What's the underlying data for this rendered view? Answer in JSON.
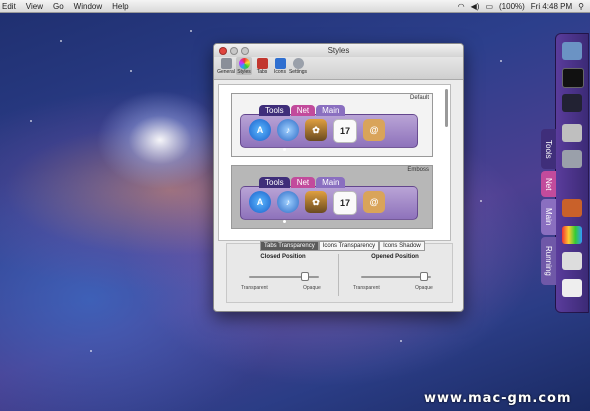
{
  "menubar": {
    "items": [
      "Edit",
      "View",
      "Go",
      "Window",
      "Help"
    ],
    "battery": "(100%)",
    "clock": "Fri 4:48 PM"
  },
  "window": {
    "title": "Styles",
    "toolbar": [
      "General",
      "Styles",
      "Tabs",
      "Icons",
      "Settings"
    ],
    "previews": [
      {
        "label": "Default",
        "tabs": [
          "Tools",
          "Net",
          "Main"
        ]
      },
      {
        "label": "Emboss",
        "tabs": [
          "Tools",
          "Net",
          "Main"
        ]
      }
    ],
    "calendar_day": "17",
    "segments": [
      "Tabs Transparency",
      "Icons Transparency",
      "Icons Shadow"
    ],
    "closed_position": {
      "title": "Closed Position",
      "min": "Transparent",
      "max": "Opaque",
      "level": 0.8
    },
    "opened_position": {
      "title": "Opened Position",
      "min": "Transparent",
      "max": "Opaque",
      "level": 0.9
    }
  },
  "sidedock": {
    "tabs": [
      "Tools",
      "Net",
      "Main",
      "Running"
    ]
  },
  "watermark": "www.mac-gm.com"
}
